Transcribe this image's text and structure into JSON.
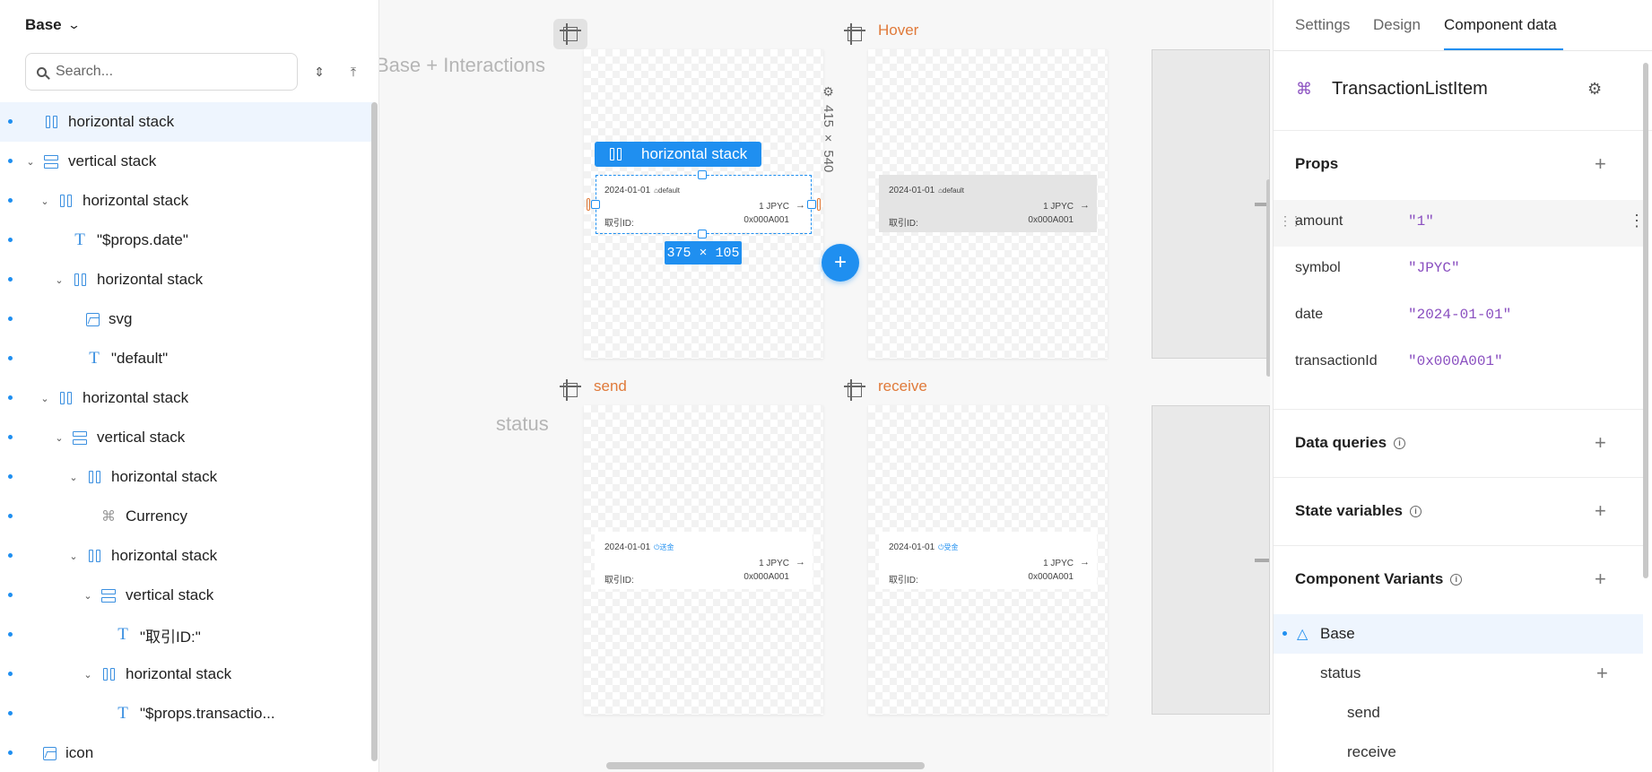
{
  "left": {
    "title": "Base",
    "search_placeholder": "Search...",
    "tree": [
      {
        "label": "horizontal stack",
        "type": "hstack",
        "depth": 0,
        "chevron": false,
        "selected": true
      },
      {
        "label": "vertical stack",
        "type": "vstack",
        "depth": 0,
        "chevron": true
      },
      {
        "label": "horizontal stack",
        "type": "hstack",
        "depth": 1,
        "chevron": true
      },
      {
        "label": "\"$props.date\"",
        "type": "text",
        "depth": 2,
        "chevron": false
      },
      {
        "label": "horizontal stack",
        "type": "hstack",
        "depth": 2,
        "chevron": true
      },
      {
        "label": "svg",
        "type": "image",
        "depth": 3,
        "chevron": false
      },
      {
        "label": "\"default\"",
        "type": "text",
        "depth": 3,
        "chevron": false
      },
      {
        "label": "horizontal stack",
        "type": "hstack",
        "depth": 1,
        "chevron": true
      },
      {
        "label": "vertical stack",
        "type": "vstack",
        "depth": 2,
        "chevron": true
      },
      {
        "label": "horizontal stack",
        "type": "hstack",
        "depth": 3,
        "chevron": true
      },
      {
        "label": "Currency",
        "type": "component",
        "depth": 4,
        "chevron": false
      },
      {
        "label": "horizontal stack",
        "type": "hstack",
        "depth": 3,
        "chevron": true
      },
      {
        "label": "vertical stack",
        "type": "vstack",
        "depth": 4,
        "chevron": true
      },
      {
        "label": "\"取引ID:\"",
        "type": "text",
        "depth": 5,
        "chevron": false
      },
      {
        "label": "horizontal stack",
        "type": "hstack",
        "depth": 4,
        "chevron": true
      },
      {
        "label": "\"$props.transactio...",
        "type": "text",
        "depth": 5,
        "chevron": false
      },
      {
        "label": "icon",
        "type": "image",
        "depth": 0,
        "chevron": false
      }
    ]
  },
  "canvas": {
    "row1_label": "Base + Interactions",
    "row2_label": "status",
    "variants": {
      "hover": "Hover",
      "send": "send",
      "receive": "receive"
    },
    "card": {
      "date": "2024-01-01",
      "status_default": "default",
      "status_send": "送金",
      "status_receive": "受金",
      "amount": "1 JPYC",
      "arrow": "→",
      "txid_label": "取引ID:",
      "txid_value": "0x000A001"
    },
    "selection_label": "horizontal stack",
    "selection_size": "375 × 105",
    "board_size": "415 × 540",
    "add_label": "+"
  },
  "right": {
    "tabs": [
      "Settings",
      "Design",
      "Component data"
    ],
    "active_tab": 2,
    "component_name": "TransactionListItem",
    "props_title": "Props",
    "props": [
      {
        "key": "amount",
        "value": "\"1\""
      },
      {
        "key": "symbol",
        "value": "\"JPYC\""
      },
      {
        "key": "date",
        "value": "\"2024-01-01\""
      },
      {
        "key": "transactionId",
        "value": "\"0x000A001\""
      }
    ],
    "data_queries_title": "Data queries",
    "state_variables_title": "State variables",
    "component_variants_title": "Component Variants",
    "variant_base": "Base",
    "variant_group": "status",
    "variant_options": [
      "send",
      "receive"
    ]
  },
  "colors": {
    "accent": "#1f8ff0",
    "variant_label": "#e07a3a",
    "prop_value": "#8a4fc0"
  }
}
